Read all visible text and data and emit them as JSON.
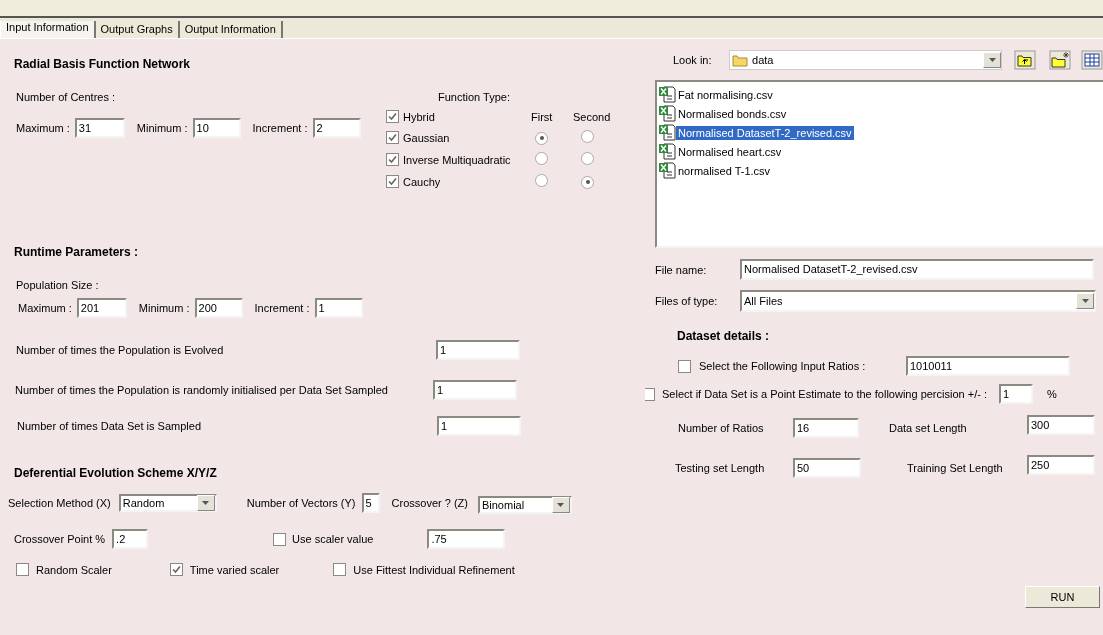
{
  "tabs": [
    {
      "label": "Input Information",
      "selected": true
    },
    {
      "label": "Output Graphs",
      "selected": false
    },
    {
      "label": "Output Information",
      "selected": false
    }
  ],
  "rbf": {
    "title": "Radial Basis Function Network",
    "centres_label": "Number of Centres :",
    "centres": [
      {
        "label": "Maximum :",
        "value": "31"
      },
      {
        "label": "Minimum :",
        "value": "10"
      },
      {
        "label": "Increment :",
        "value": "2"
      }
    ],
    "function_type": {
      "title": "Function Type:",
      "column_headers": [
        "First",
        "Second"
      ],
      "items": [
        {
          "label": "Hybrid",
          "checked": true
        },
        {
          "label": "Gaussian",
          "checked": true,
          "radios": [
            {
              "selected": true
            },
            {
              "selected": false
            }
          ]
        },
        {
          "label": "Inverse Multiquadratic",
          "checked": true,
          "radios": [
            {
              "selected": false
            },
            {
              "selected": false
            }
          ]
        },
        {
          "label": "Cauchy",
          "checked": true,
          "radios": [
            {
              "selected": false
            },
            {
              "selected": true
            }
          ]
        }
      ]
    }
  },
  "runtime": {
    "title": "Runtime Parameters :",
    "population_label": "Population Size :",
    "population": [
      {
        "label": "Maximum :",
        "value": "201"
      },
      {
        "label": "Minimum :",
        "value": "200"
      },
      {
        "label": "Increment :",
        "value": "1"
      }
    ],
    "params": [
      {
        "label": "Number of times the Population is Evolved",
        "value": "1"
      },
      {
        "label": "Number of times the Population is randomly initialised per Data Set Sampled",
        "value": "1"
      },
      {
        "label": "Number of times Data Set is Sampled",
        "value": "1"
      }
    ]
  },
  "de": {
    "title": "Deferential Evolution Scheme X/Y/Z",
    "selection": {
      "label": "Selection Method (X)",
      "value": "Random"
    },
    "vectors": {
      "label": "Number of Vectors (Y)",
      "value": "5"
    },
    "crossover": {
      "label": "Crossover ? (Z)",
      "value": "Binomial"
    },
    "crossover_point": {
      "label": "Crossover Point %",
      "value": ".2"
    },
    "use_scaler": {
      "label": "Use scaler value",
      "checked": false,
      "value": ".75"
    },
    "options": [
      {
        "label": "Random Scaler",
        "checked": false
      },
      {
        "label": "Time varied scaler",
        "checked": true
      },
      {
        "label": "Use Fittest Individual Refinement",
        "checked": false
      }
    ]
  },
  "file_chooser": {
    "look_in_label": "Look in:",
    "look_in": "data",
    "files": [
      {
        "name": "Fat normalising.csv",
        "selected": false
      },
      {
        "name": "Normalised bonds.csv",
        "selected": false
      },
      {
        "name": "Normalised DatasetT-2_revised.csv",
        "selected": true
      },
      {
        "name": "Normalised heart.csv",
        "selected": false
      },
      {
        "name": "normalised T-1.csv",
        "selected": false
      }
    ],
    "file_name_label": "File name:",
    "file_name": "Normalised DatasetT-2_revised.csv",
    "file_type_label": "Files of type:",
    "file_type": "All Files"
  },
  "dataset": {
    "title": "Dataset details :",
    "input_ratios": {
      "label": "Select the Following Input Ratios :",
      "checked": false,
      "value": "1010011"
    },
    "point_estimate": {
      "label": "Select if Data Set is a Point Estimate to the following percision +/- :",
      "checked": false,
      "value": "1",
      "unit": "%"
    },
    "fields": [
      {
        "label": "Number of Ratios",
        "value": "16"
      },
      {
        "label": "Data set Length",
        "value": "300"
      },
      {
        "label": "Testing set Length",
        "value": "50"
      },
      {
        "label": "Training Set Length",
        "value": "250"
      }
    ]
  },
  "run_button": "RUN"
}
